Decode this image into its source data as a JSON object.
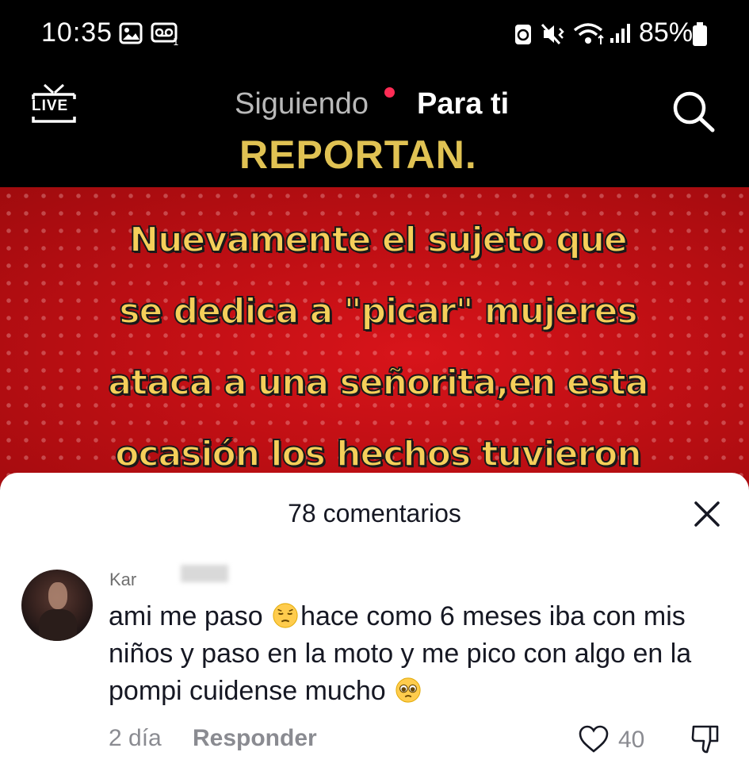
{
  "status_bar": {
    "time": "10:35",
    "battery_percent": "85%",
    "icons": [
      "image-notification-icon",
      "voicemail-icon",
      "battery-saver-icon",
      "mute-vibrate-icon",
      "wifi-icon",
      "signal-icon",
      "battery-icon"
    ]
  },
  "top_nav": {
    "live_label": "LIVE",
    "tabs": [
      {
        "label": "Siguiendo",
        "active": false,
        "has_notification_dot": true
      },
      {
        "label": "Para ti",
        "active": true
      }
    ]
  },
  "video": {
    "brand": "REPORTAN.",
    "caption_lines": [
      "Nuevamente el sujeto que",
      "se dedica a \"picar\" mujeres",
      "ataca a una señorita,en esta",
      "ocasión los hechos tuvieron"
    ]
  },
  "comments_sheet": {
    "title": "78 comentarios",
    "comment": {
      "username": "Kar",
      "text_part1": "ami me paso ",
      "text_part2": "hace como 6 meses iba con mis niños y paso en la moto y me pico con algo en la pompi cuidense mucho ",
      "emoji1": "pensive-face",
      "emoji2": "pleading-face",
      "date": "2 día",
      "reply_label": "Responder",
      "like_count": "40"
    }
  },
  "colors": {
    "accent_pink": "#fe2c55",
    "video_red": "#c00f14",
    "caption_yellow": "#f5cf5a",
    "brand_gold": "#e0c253"
  }
}
